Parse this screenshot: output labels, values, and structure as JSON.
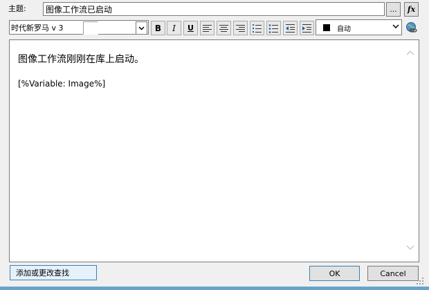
{
  "subject": {
    "label": "主题:",
    "value": "图像工作流已启动"
  },
  "buttons": {
    "ellipsis": "...",
    "fx": "fx"
  },
  "toolbar": {
    "font_name": "时代新罗马 v 3",
    "bold": "B",
    "italic": "I",
    "underline": "U",
    "color_label": "自动"
  },
  "editor": {
    "line1": "图像工作流刚刚在库上启动。",
    "line2": "[%Variable: Image%]"
  },
  "footer": {
    "add_change_lookup": "添加或更改查找",
    "ok": "OK",
    "cancel": "Cancel"
  },
  "colors": {
    "window_bg": "#f0f0f0",
    "accent_border": "#3c7fb1",
    "bottom_strip": "#6aa3c9"
  }
}
